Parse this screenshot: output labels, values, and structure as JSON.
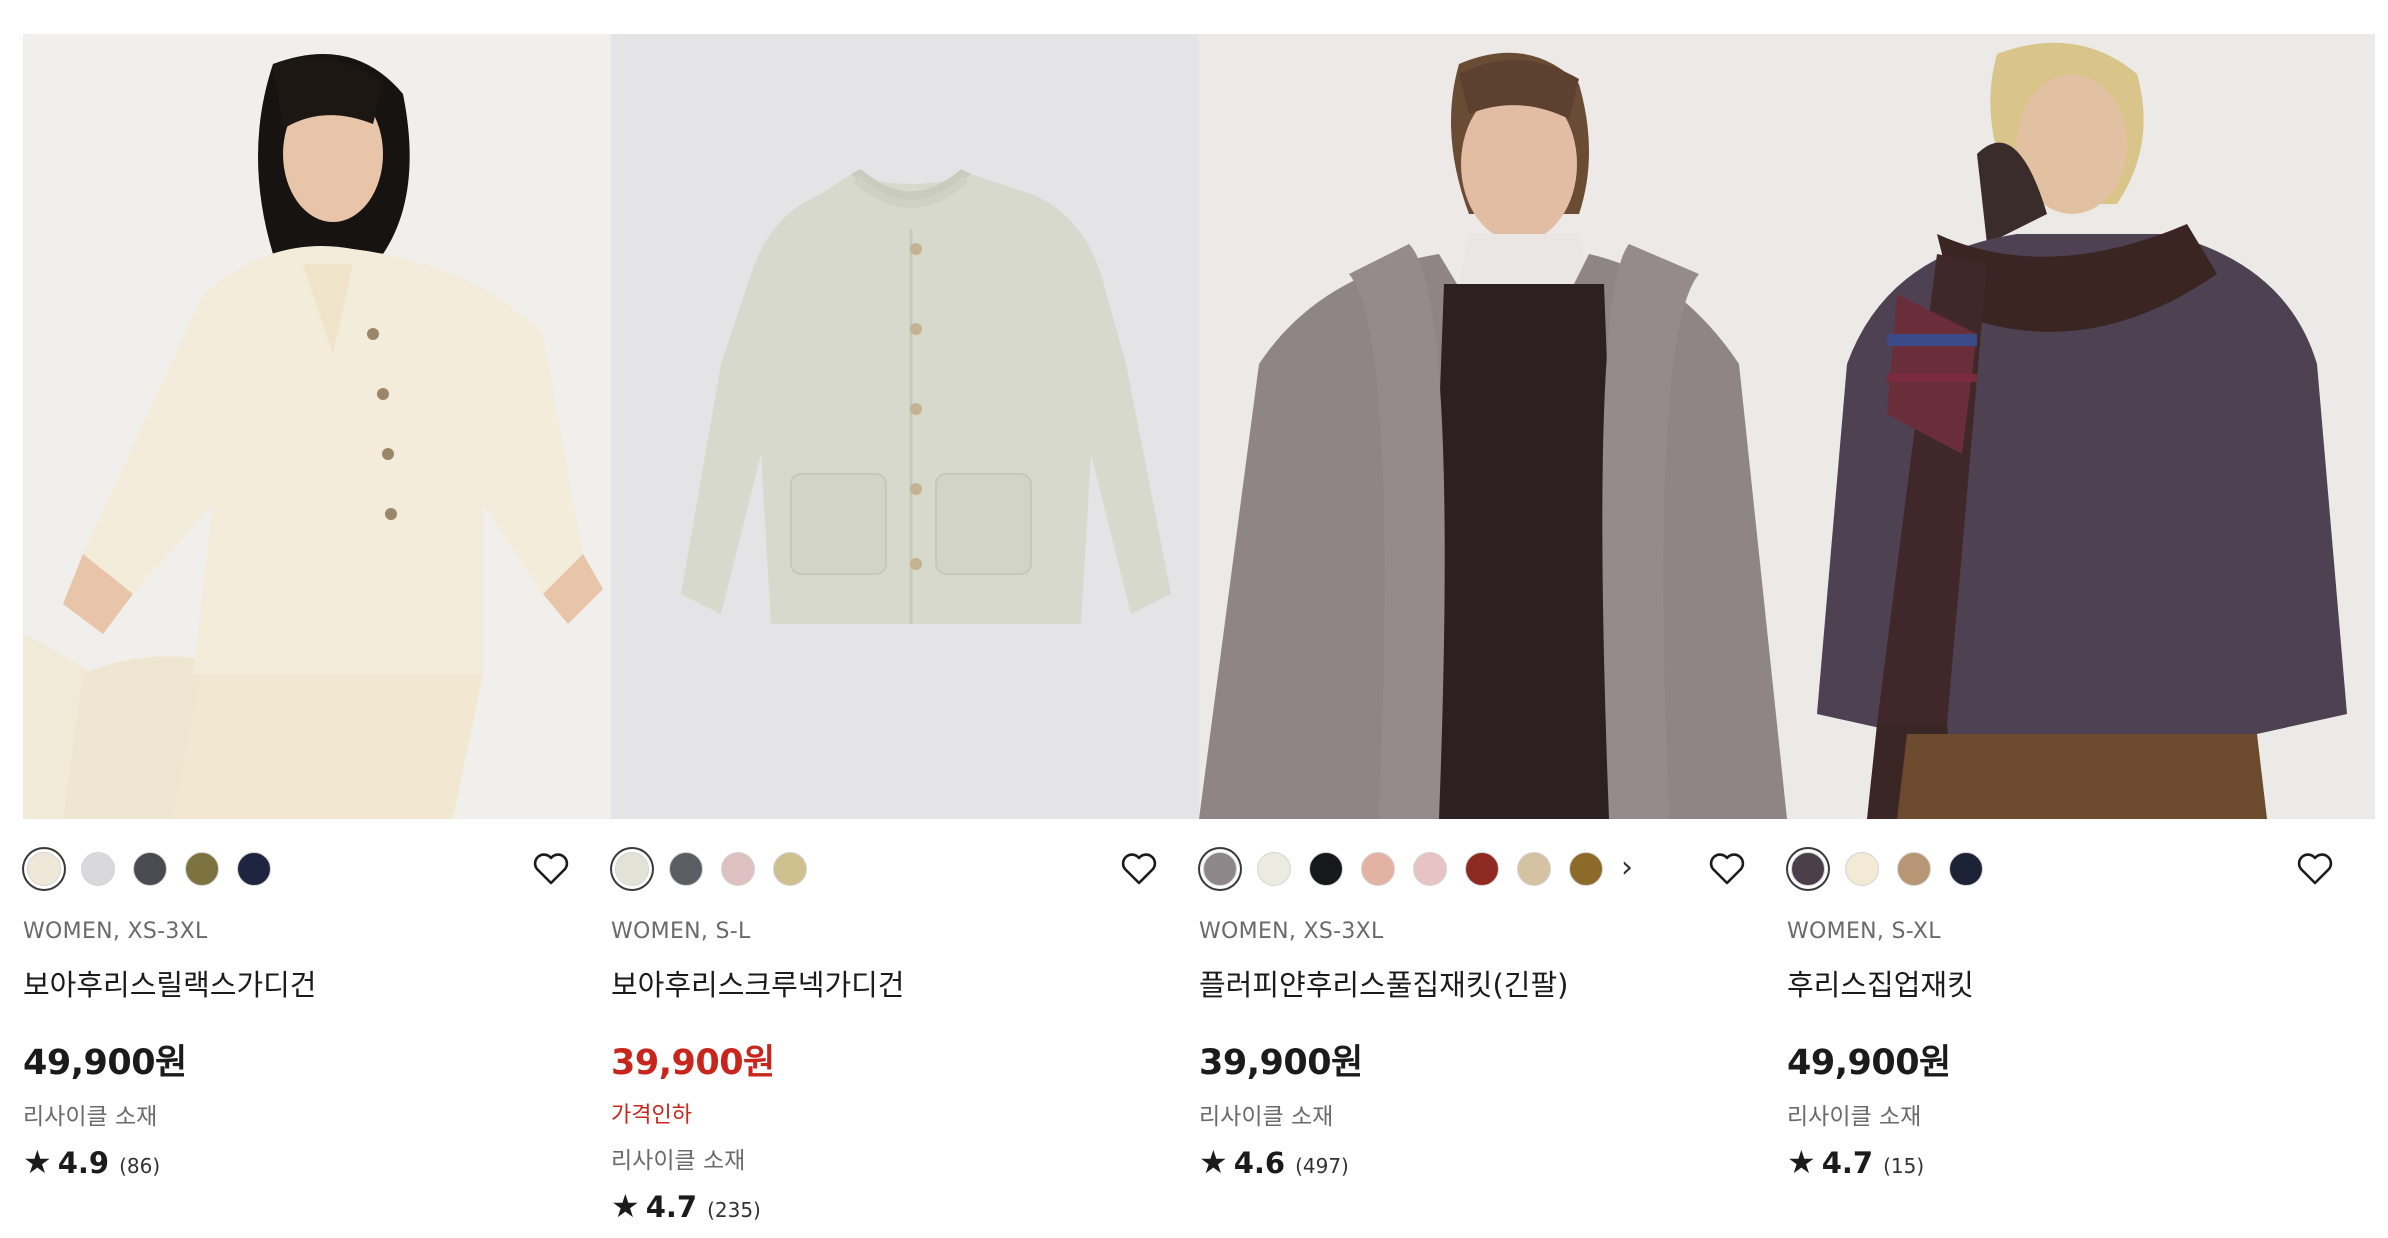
{
  "products": [
    {
      "image_alt": "보아후리스릴랙스가디건",
      "swatches": [
        "#efe8d9",
        "#d9d9db",
        "#4a4b50",
        "#7d7341",
        "#1f2540"
      ],
      "selected_swatch": 0,
      "show_more": false,
      "meta": "WOMEN, XS-3XL",
      "name": "보아후리스릴랙스가디건",
      "price": "49,900원",
      "on_sale": false,
      "sale_label": "",
      "note": "리사이클 소재",
      "rating": "4.9",
      "review_count": "(86)"
    },
    {
      "image_alt": "보아후리스크루넥가디건",
      "swatches": [
        "#e4e2d6",
        "#5b5d62",
        "#dcc1c0",
        "#cfc08f"
      ],
      "selected_swatch": 0,
      "show_more": false,
      "meta": "WOMEN, S-L",
      "name": "보아후리스크루넥가디건",
      "price": "39,900원",
      "on_sale": true,
      "sale_label": "가격인하",
      "note": "리사이클 소재",
      "rating": "4.7",
      "review_count": "(235)"
    },
    {
      "image_alt": "플러피얀후리스풀집재킷(긴팔)",
      "swatches": [
        "#8e8789",
        "#ecebe2",
        "#17181c",
        "#e2b2a2",
        "#e8c3c6",
        "#8e2a22",
        "#d4c2a2",
        "#8c6a2a"
      ],
      "selected_swatch": 0,
      "show_more": true,
      "meta": "WOMEN, XS-3XL",
      "name": "플러피얀후리스풀집재킷(긴팔)",
      "price": "39,900원",
      "on_sale": false,
      "sale_label": "",
      "note": "리사이클 소재",
      "rating": "4.6",
      "review_count": "(497)"
    },
    {
      "image_alt": "후리스집업재킷",
      "swatches": [
        "#4b3f4c",
        "#f2ead5",
        "#b69674",
        "#1d2336"
      ],
      "selected_swatch": 0,
      "show_more": false,
      "meta": "WOMEN, S-XL",
      "name": "후리스집업재킷",
      "price": "49,900원",
      "on_sale": false,
      "sale_label": "",
      "note": "리사이클 소재",
      "rating": "4.7",
      "review_count": "(15)"
    }
  ],
  "more_colors_glyph": "›",
  "star_glyph": "★",
  "colors": {
    "sale_red": "#c8261c",
    "text": "#1b1b1b",
    "muted": "#6a6a6a"
  },
  "icons": {
    "wishlist": "heart-outline-icon",
    "more_colors": "chevron-right-icon",
    "rating": "star-icon"
  }
}
